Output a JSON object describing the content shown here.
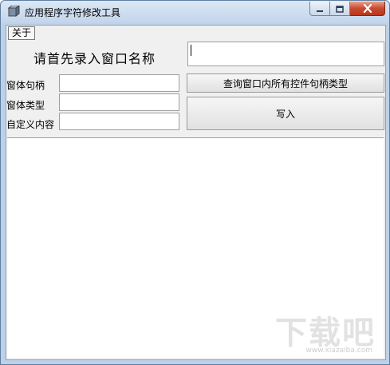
{
  "window": {
    "title": "应用程序字符修改工具",
    "accent": "#bcd0e8",
    "close_color": "#c94a2f"
  },
  "menubar": {
    "items": [
      {
        "label": "关于"
      }
    ]
  },
  "form": {
    "prompt_label": "请首先录入窗口名称",
    "window_name_value": "",
    "handle_label": "窗体句柄",
    "handle_value": "",
    "type_label": "窗体类型",
    "type_value": "",
    "custom_label": "自定义内容",
    "custom_value": ""
  },
  "buttons": {
    "query_label": "查询窗口内所有控件句柄类型",
    "write_label": "写入"
  },
  "output": {
    "text": ""
  },
  "watermark": {
    "text": "下载吧",
    "sub": "www.xiazaiba.com"
  }
}
